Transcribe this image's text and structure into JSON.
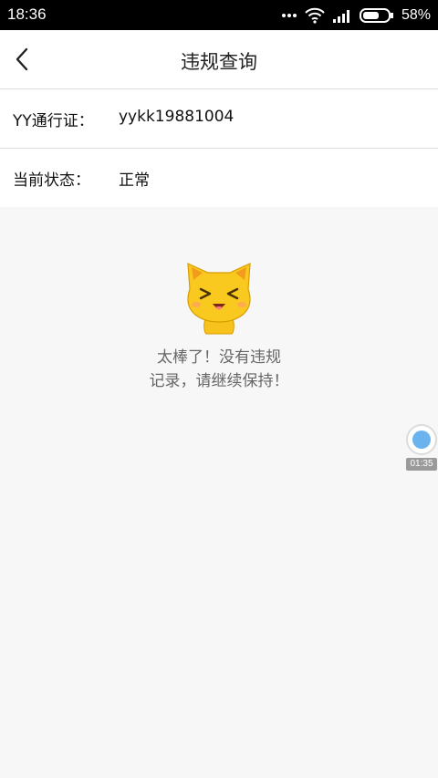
{
  "status_bar": {
    "time": "18:36",
    "battery_percent": "58%",
    "icons": [
      "more-dots-icon",
      "wifi-icon",
      "signal-icon",
      "battery-icon"
    ]
  },
  "header": {
    "title": "违规查询",
    "back_icon": "back-chevron-icon"
  },
  "info": {
    "pass_label": "YY通行证：",
    "pass_value": "yykk19881004",
    "status_label": "当前状态：",
    "status_value": "正常"
  },
  "empty_state": {
    "illustration": "happy-cat-icon",
    "line1": "太棒了！没有违规",
    "line2": "记录，请继续保持！"
  },
  "recorder": {
    "icon": "record-dot-icon",
    "time": "01:35"
  },
  "colors": {
    "accent_blue": "#6ab3ee",
    "cat_yellow": "#f7c21c",
    "page_bg": "#f7f7f7"
  }
}
